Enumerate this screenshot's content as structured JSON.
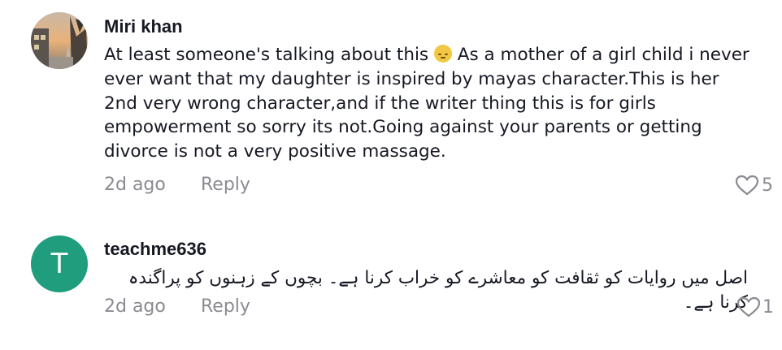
{
  "comments": [
    {
      "username": "Miri khan",
      "text_before_emoji": "At least someone's talking about this ",
      "emoji": "pensive-face",
      "text_after_emoji": " As a mother of a girl child i never ever want that my daughter is inspired by mayas character.This is her 2nd very wrong character,and if the writer thing this is for girls empowerment so sorry its not.Going against your parents or getting divorce is not a very positive massage.",
      "time": "2d ago",
      "reply_label": "Reply",
      "likes": "5",
      "avatar_icon": "profile-photo"
    },
    {
      "username": "teachme636",
      "avatar_letter": "T",
      "avatar_color": "#1f9d7d",
      "text": "اصل میں روایات کو ثقافت کو معاشرے کو خراب کرنا ہے۔ بچوں کے زہنوں کو پراگندہ کرنا ہے۔",
      "time": "2d ago",
      "reply_label": "Reply",
      "likes": "1"
    }
  ]
}
